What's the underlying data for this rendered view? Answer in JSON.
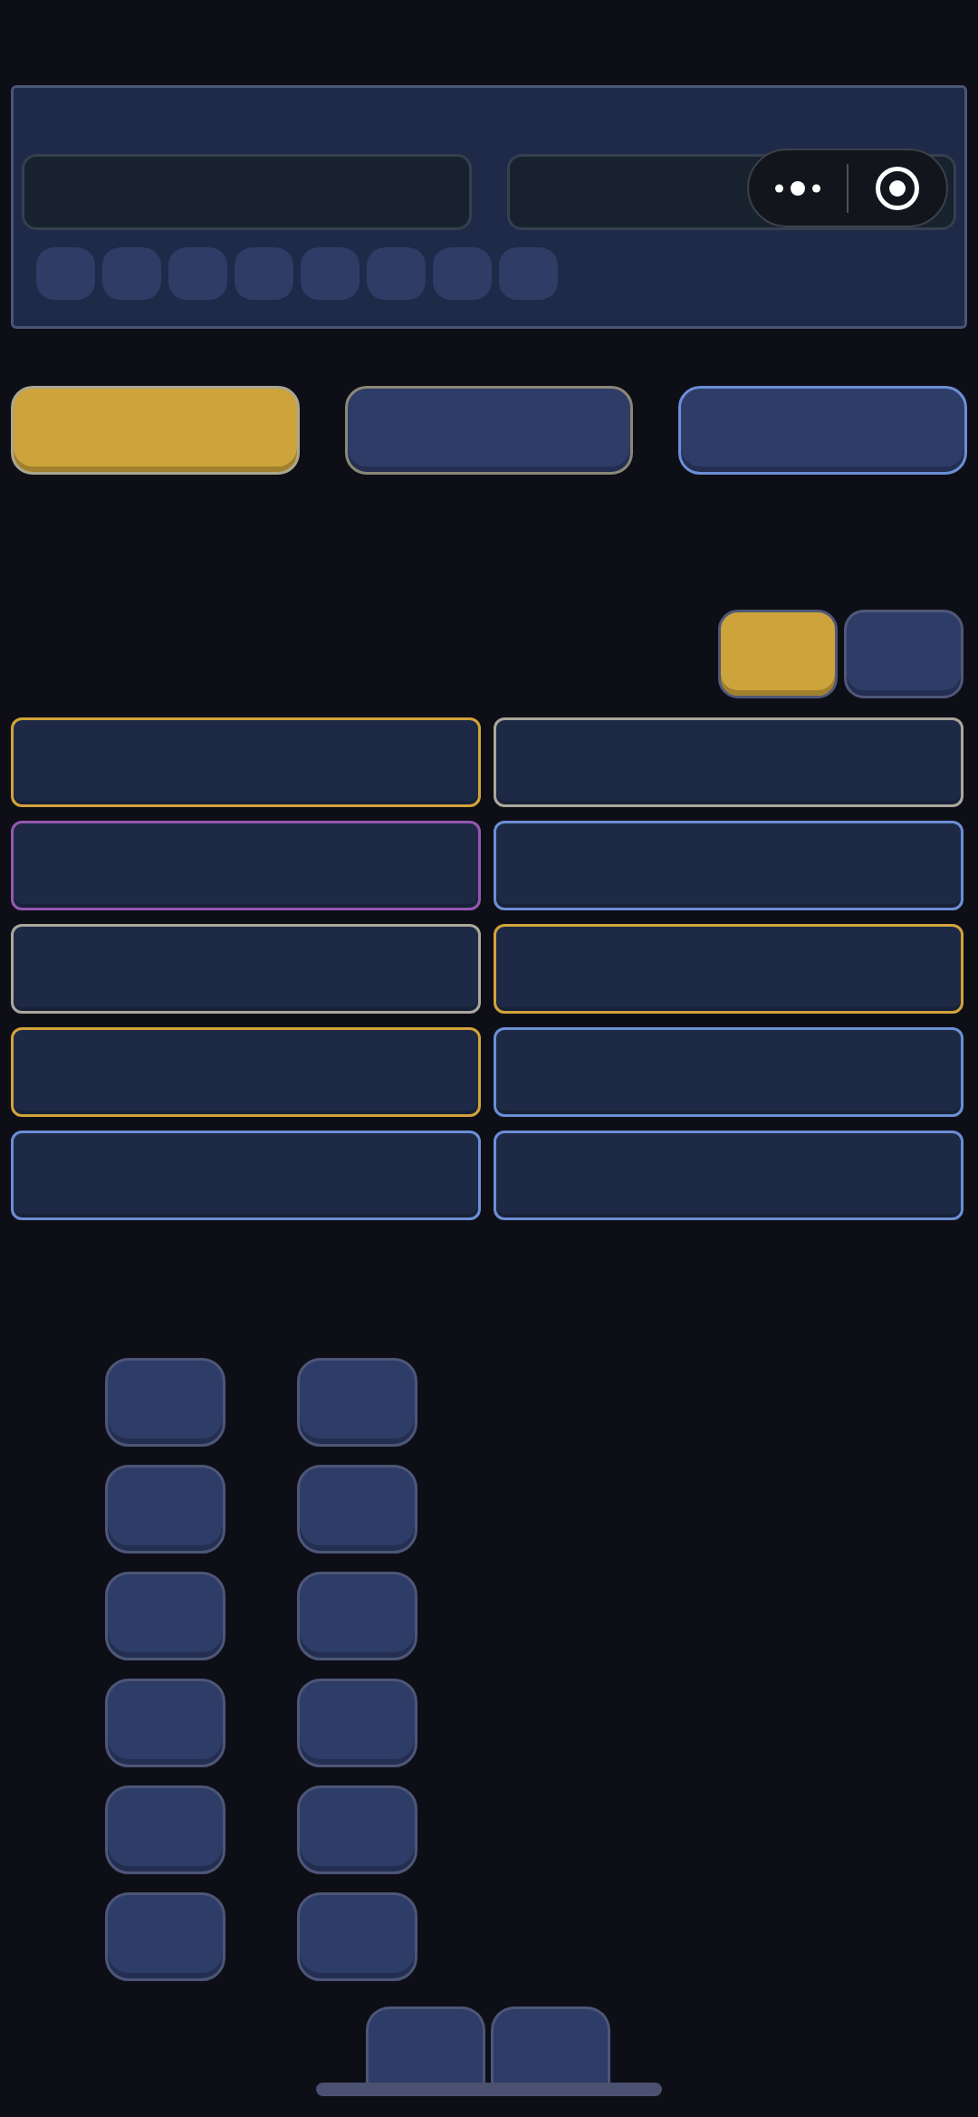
{
  "header_panel": {
    "inputs": [
      {
        "kind": "text"
      },
      {
        "kind": "text"
      }
    ],
    "chips": [
      {
        "selected": false
      },
      {
        "selected": false
      },
      {
        "selected": false
      },
      {
        "selected": false
      },
      {
        "selected": false
      },
      {
        "selected": false
      },
      {
        "selected": false
      },
      {
        "selected": false
      }
    ]
  },
  "capsule": {
    "buttons": [
      {
        "kind": "more"
      },
      {
        "kind": "close"
      }
    ]
  },
  "mode_buttons": [
    {
      "selected": true,
      "color": "#aba690"
    },
    {
      "selected": false,
      "color": "#8a8876"
    },
    {
      "selected": false,
      "color": "#6b8fd6"
    }
  ],
  "toggles": [
    {
      "selected": true
    },
    {
      "selected": false
    }
  ],
  "cards": [
    {
      "color": "#d2a33a"
    },
    {
      "color": "#a9a79c"
    },
    {
      "color": "#9457b0"
    },
    {
      "color": "#6b8ed4"
    },
    {
      "color": "#a9a79c"
    },
    {
      "color": "#d2a33a"
    },
    {
      "color": "#d2a33a"
    },
    {
      "color": "#6b8ed4"
    },
    {
      "color": "#6b8ed4"
    },
    {
      "color": "#6b8ed4"
    }
  ],
  "keys": [
    {
      "kind": "key"
    },
    {
      "kind": "key"
    },
    {
      "kind": "key"
    },
    {
      "kind": "key"
    },
    {
      "kind": "key"
    },
    {
      "kind": "key"
    },
    {
      "kind": "key"
    },
    {
      "kind": "key"
    },
    {
      "kind": "key"
    },
    {
      "kind": "key"
    },
    {
      "kind": "key"
    },
    {
      "kind": "key"
    }
  ],
  "bottom_keys": [
    {
      "kind": "key"
    },
    {
      "kind": "key"
    }
  ],
  "home_indicator": {
    "visible": true
  }
}
